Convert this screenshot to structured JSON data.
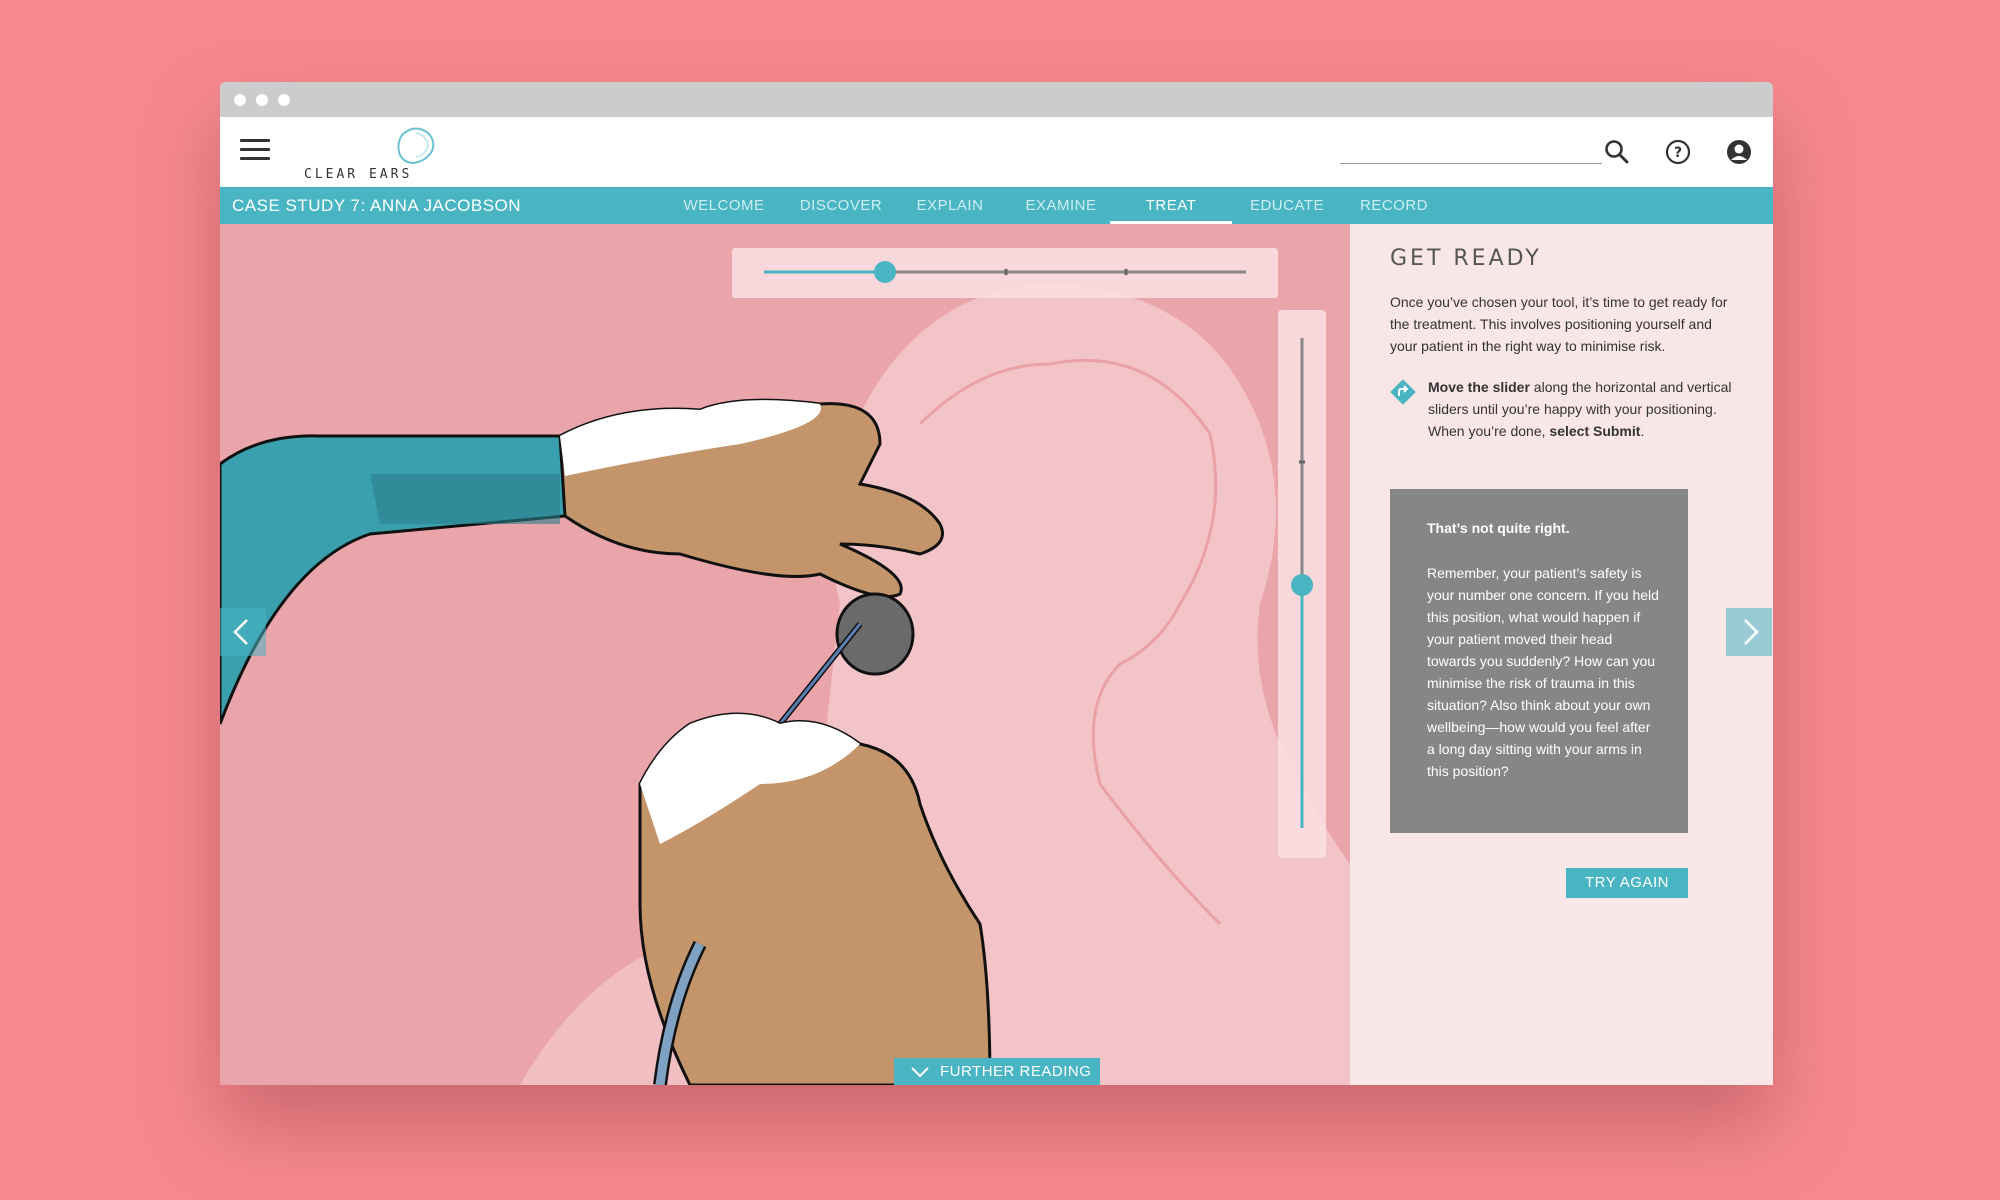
{
  "app": {
    "logo_text": "CLEAR EARS"
  },
  "search": {
    "placeholder": ""
  },
  "nav": {
    "case_title": "CASE STUDY 7: ANNA JACOBSON",
    "tabs": [
      {
        "label": "WELCOME"
      },
      {
        "label": "DISCOVER"
      },
      {
        "label": "EXPLAIN"
      },
      {
        "label": "EXAMINE"
      },
      {
        "label": "TREAT",
        "active": true
      },
      {
        "label": "EDUCATE"
      },
      {
        "label": "RECORD"
      }
    ]
  },
  "stage": {
    "horizontal_slider_value": 0.25,
    "vertical_slider_value": 0.5,
    "further_reading_label": "FURTHER READING"
  },
  "panel": {
    "heading": "GET READY",
    "intro": "Once you’ve chosen your tool, it’s time to get ready for the treatment. This involves positioning yourself and your patient in the right way to minimise risk.",
    "instruction": {
      "bold1": "Move the slider",
      "text1": " along the horizontal and vertical sliders until you’re happy with your positioning. When you’re done, ",
      "bold2": "select Submit",
      "text2": "."
    },
    "feedback": {
      "title": "That’s not quite right.",
      "body": "Remember, your patient’s safety is your number one concern. If you held this position, what would happen if your patient moved their head towards you suddenly? How can you minimise the risk of trauma in this situation? Also think about your own wellbeing—how would you feel after a long day sitting with your arms in this position?"
    },
    "try_again_label": "TRY AGAIN"
  },
  "colors": {
    "background": "#f6898f",
    "accent": "#49b4c2",
    "stage": "#eaa5aa",
    "panel": "#f9e6e7",
    "feedback": "#868686"
  }
}
